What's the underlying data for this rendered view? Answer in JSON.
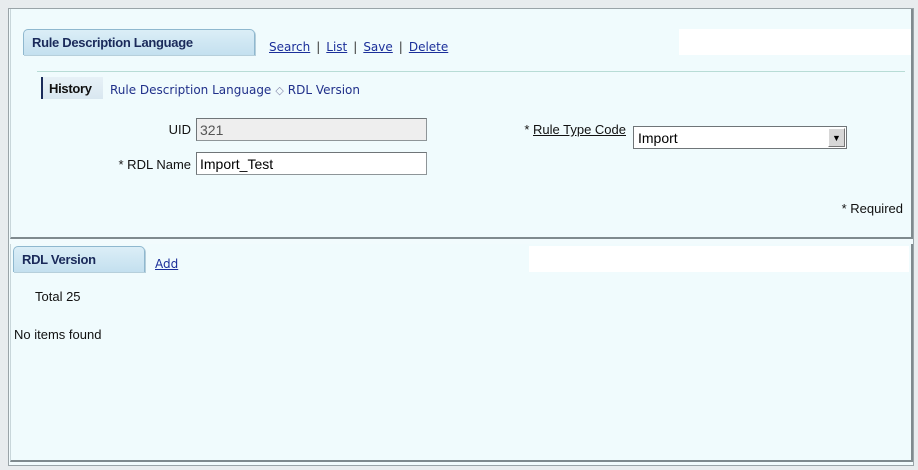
{
  "main_panel": {
    "tab_title": "Rule Description Language",
    "actions": {
      "search": "Search",
      "list": "List",
      "save": "Save",
      "delete": "Delete",
      "separator": "|"
    },
    "history": {
      "label": "History",
      "crumb_1": "Rule Description Language",
      "crumb_sep": "◇",
      "crumb_2": "RDL Version"
    },
    "form": {
      "uid_label": "UID",
      "uid_value": "321",
      "rdl_name_label": "* RDL Name",
      "rdl_name_value": "Import_Test",
      "rule_type_required": "*",
      "rule_type_label": "Rule Type Code",
      "rule_type_value": "Import",
      "required_note": "* Required"
    }
  },
  "version_panel": {
    "tab_title": "RDL Version",
    "add_label": "Add",
    "total_text": "Total 25",
    "empty_text": "No items found"
  },
  "colors": {
    "tab_text": "#1a2a5a",
    "link": "#1b2f9a",
    "panel_bg": "#f0fbfd"
  }
}
